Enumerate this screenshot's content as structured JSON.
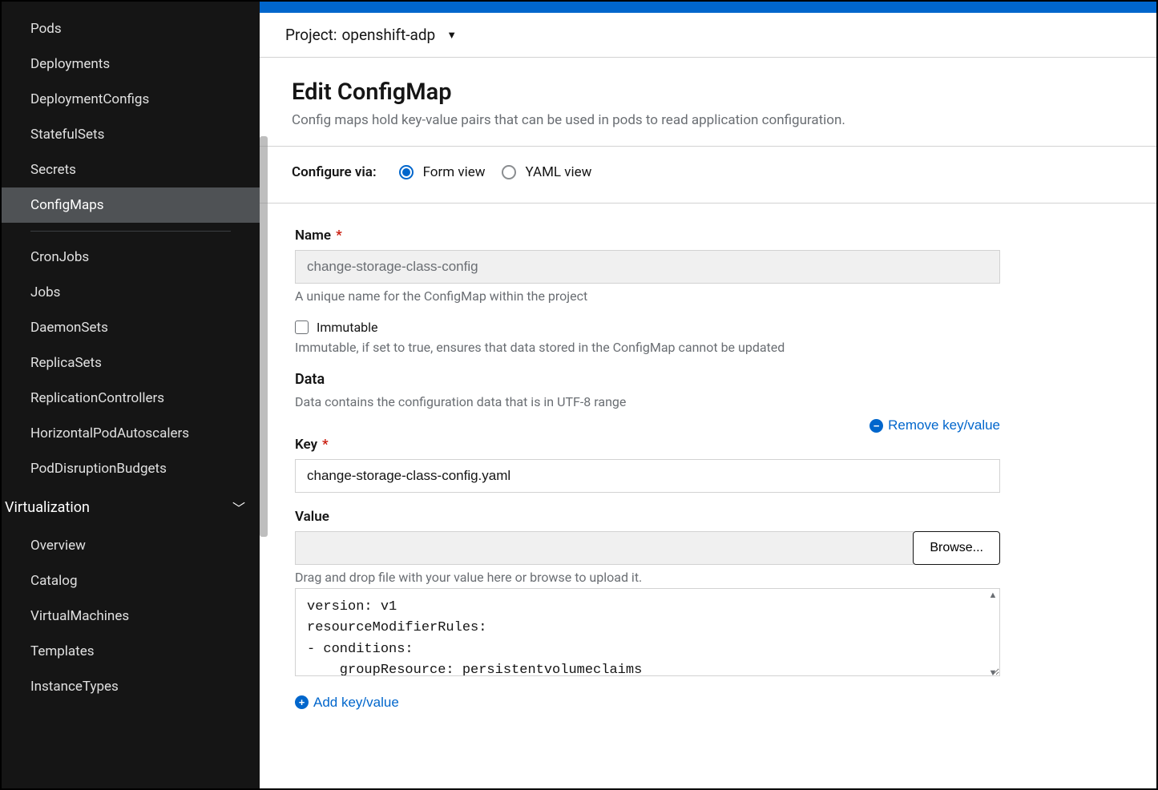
{
  "sidebar": {
    "group1": [
      {
        "label": "Pods"
      },
      {
        "label": "Deployments"
      },
      {
        "label": "DeploymentConfigs"
      },
      {
        "label": "StatefulSets"
      },
      {
        "label": "Secrets"
      },
      {
        "label": "ConfigMaps",
        "active": true
      }
    ],
    "group2": [
      {
        "label": "CronJobs"
      },
      {
        "label": "Jobs"
      },
      {
        "label": "DaemonSets"
      },
      {
        "label": "ReplicaSets"
      },
      {
        "label": "ReplicationControllers"
      },
      {
        "label": "HorizontalPodAutoscalers"
      },
      {
        "label": "PodDisruptionBudgets"
      }
    ],
    "section": {
      "label": "Virtualization"
    },
    "group3": [
      {
        "label": "Overview"
      },
      {
        "label": "Catalog"
      },
      {
        "label": "VirtualMachines"
      },
      {
        "label": "Templates"
      },
      {
        "label": "InstanceTypes"
      }
    ]
  },
  "project": {
    "prefix": "Project:",
    "name": "openshift-adp"
  },
  "page": {
    "title": "Edit ConfigMap",
    "subtitle": "Config maps hold key-value pairs that can be used in pods to read application configuration."
  },
  "configure": {
    "label": "Configure via:",
    "form": "Form view",
    "yaml": "YAML view"
  },
  "form": {
    "name_label": "Name",
    "name_value": "change-storage-class-config",
    "name_help": "A unique name for the ConfigMap within the project",
    "immutable_label": "Immutable",
    "immutable_help": "Immutable, if set to true, ensures that data stored in the ConfigMap cannot be updated",
    "data_label": "Data",
    "data_help": "Data contains the configuration data that is in UTF-8 range",
    "remove_kv": "Remove key/value",
    "key_label": "Key",
    "key_value": "change-storage-class-config.yaml",
    "value_label": "Value",
    "browse": "Browse...",
    "value_help": "Drag and drop file with your value here or browse to upload it.",
    "value_text": "version: v1\nresourceModifierRules:\n- conditions:\n    groupResource: persistentvolumeclaims",
    "add_kv": "Add key/value"
  }
}
